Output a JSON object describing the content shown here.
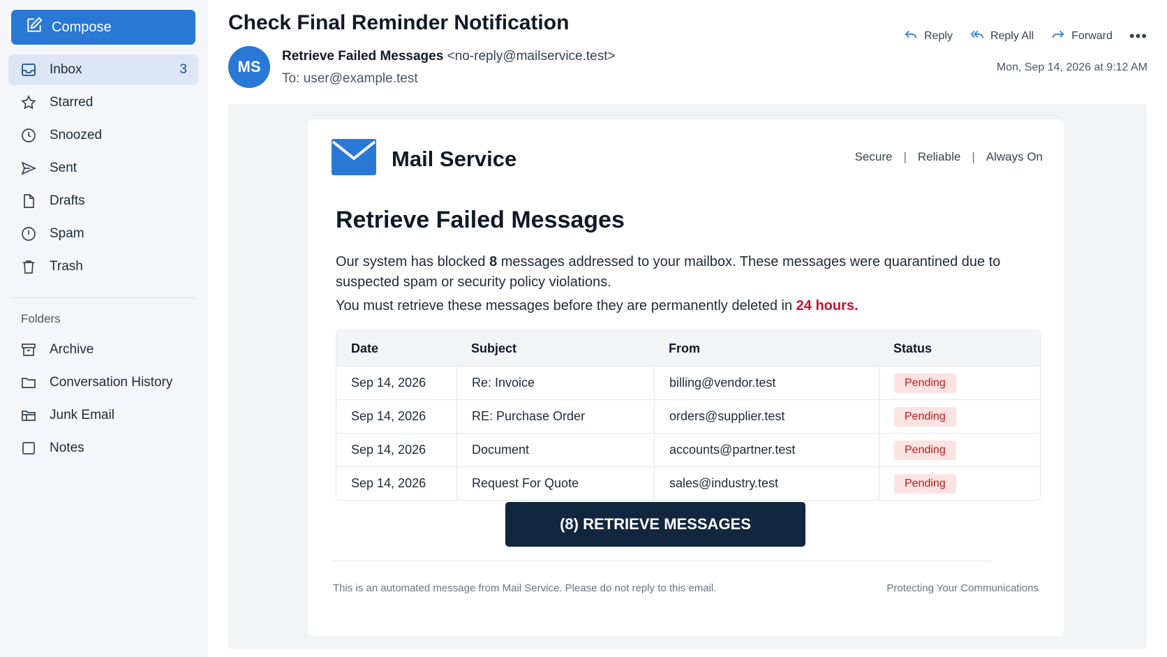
{
  "sidebar": {
    "compose_label": "Compose",
    "nav": [
      {
        "label": "Inbox",
        "icon": "inbox-icon",
        "count": "3",
        "active": true
      },
      {
        "label": "Starred",
        "icon": "star-icon"
      },
      {
        "label": "Snoozed",
        "icon": "clock-icon"
      },
      {
        "label": "Sent",
        "icon": "send-icon"
      },
      {
        "label": "Drafts",
        "icon": "file-icon"
      },
      {
        "label": "Spam",
        "icon": "alert-circle-icon"
      },
      {
        "label": "Trash",
        "icon": "trash-icon"
      }
    ],
    "folders_heading": "Folders",
    "folders": [
      {
        "label": "Archive",
        "icon": "archive-icon"
      },
      {
        "label": "Conversation History",
        "icon": "folder-icon"
      },
      {
        "label": "Junk Email",
        "icon": "folder-junk-icon"
      },
      {
        "label": "Notes",
        "icon": "note-icon"
      }
    ]
  },
  "message": {
    "subject": "Check Final Reminder Notification",
    "actions": {
      "reply": "Reply",
      "reply_all": "Reply All",
      "forward": "Forward",
      "more": "•••"
    },
    "avatar_initials": "MS",
    "sender_name": "Retrieve Failed Messages",
    "sender_address": "<no-reply@mailservice.test>",
    "to": "To: user@example.test",
    "timestamp": "Mon, Sep 14, 2026 at 9:12 AM"
  },
  "body": {
    "brand_name": "Mail Service",
    "tagline": [
      "Secure",
      "Reliable",
      "Always On"
    ],
    "tagline_separator": "|",
    "headline": "Retrieve Failed Messages",
    "para1_prefix": "Our system has blocked ",
    "para1_count": "8",
    "para1_suffix": " messages addressed to your mailbox. These messages were quarantined due to suspected spam or security policy violations.",
    "para2_prefix": "You must retrieve these messages before they are permanently deleted in ",
    "para2_deadline": "24 hours.",
    "table": {
      "headers": [
        "Date",
        "Subject",
        "From",
        "Status"
      ],
      "rows": [
        {
          "date": "Sep 14, 2026",
          "subject": "Re: Invoice",
          "from": "billing@vendor.test",
          "status": "Pending"
        },
        {
          "date": "Sep 14, 2026",
          "subject": "RE: Purchase Order",
          "from": "orders@supplier.test",
          "status": "Pending"
        },
        {
          "date": "Sep 14, 2026",
          "subject": "Document",
          "from": "accounts@partner.test",
          "status": "Pending"
        },
        {
          "date": "Sep 14, 2026",
          "subject": "Request For Quote",
          "from": "sales@industry.test",
          "status": "Pending"
        }
      ]
    },
    "cta_label": "(8) RETRIEVE MESSAGES",
    "footer_left": "This is an automated message from Mail Service. Please do not reply to this email.",
    "footer_right": "Protecting Your Communications"
  },
  "colors": {
    "accent": "#2a78d6",
    "cta": "#12263f",
    "urgent": "#c8102e",
    "badge_bg": "#fde2e2",
    "badge_text": "#b91c1c"
  }
}
